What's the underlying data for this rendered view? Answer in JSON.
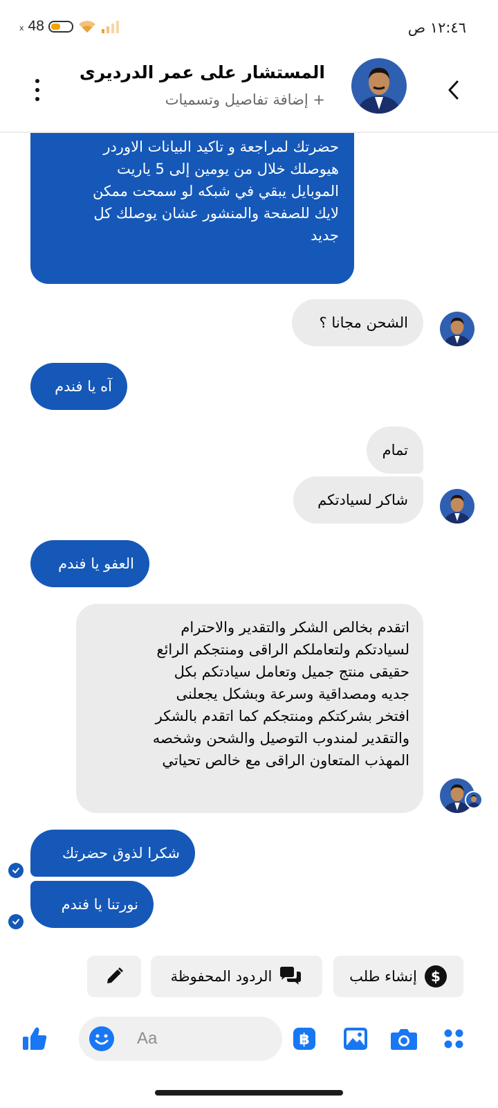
{
  "status_bar": {
    "battery_level": "48",
    "time": "١٢:٤٦ ص",
    "signal_x": "x"
  },
  "header": {
    "contact_name": "المستشار على عمر الدرديرى",
    "subtitle": "+ إضافة تفاصيل وتسميات"
  },
  "messages": [
    {
      "direction": "out",
      "lines": [
        "حضرتك لمراجعة و تاكيد البيانات الاوردر",
        "هيوصلك خلال من يومين إلى 5 ياريت",
        "الموبايل يبقي في شبكه لو سمحت ممكن",
        "لايك للصفحة والمنشور عشان يوصلك كل",
        "جديد"
      ]
    },
    {
      "direction": "in",
      "lines": [
        "الشحن مجانا ؟"
      ]
    },
    {
      "direction": "out",
      "lines": [
        "آه يا فندم"
      ]
    },
    {
      "direction": "in",
      "lines": [
        "تمام"
      ]
    },
    {
      "direction": "in",
      "lines": [
        "شاكر لسيادتكم"
      ]
    },
    {
      "direction": "out",
      "lines": [
        "العفو يا فندم"
      ]
    },
    {
      "direction": "in",
      "lines": [
        "اتقدم بخالص الشكر والتقدير والاحترام",
        "لسيادتكم ولتعاملكم الراقى ومنتجكم الرائع",
        "حقيقى منتج جميل وتعامل سيادتكم بكل",
        "جديه ومصداقية وسرعة وبشكل يجعلنى",
        "افتخر بشركتكم ومنتجكم كما اتقدم بالشكر",
        "والتقدير لمندوب التوصيل والشحن وشخصه",
        "المهذب المتعاون الراقى مع خالص تحياتي"
      ]
    },
    {
      "direction": "out",
      "lines": [
        "شكرا لذوق حضرتك"
      ],
      "seen": true
    },
    {
      "direction": "out",
      "lines": [
        "نورتنا يا فندم"
      ],
      "seen": true
    }
  ],
  "quick_replies": {
    "create_order": "إنشاء طلب",
    "saved_replies": "الردود المحفوظة"
  },
  "composer": {
    "placeholder": "Aa"
  },
  "colors": {
    "outgoing_bubble": "#1558b8",
    "incoming_bubble": "#ebebeb",
    "accent": "#1877f2"
  }
}
